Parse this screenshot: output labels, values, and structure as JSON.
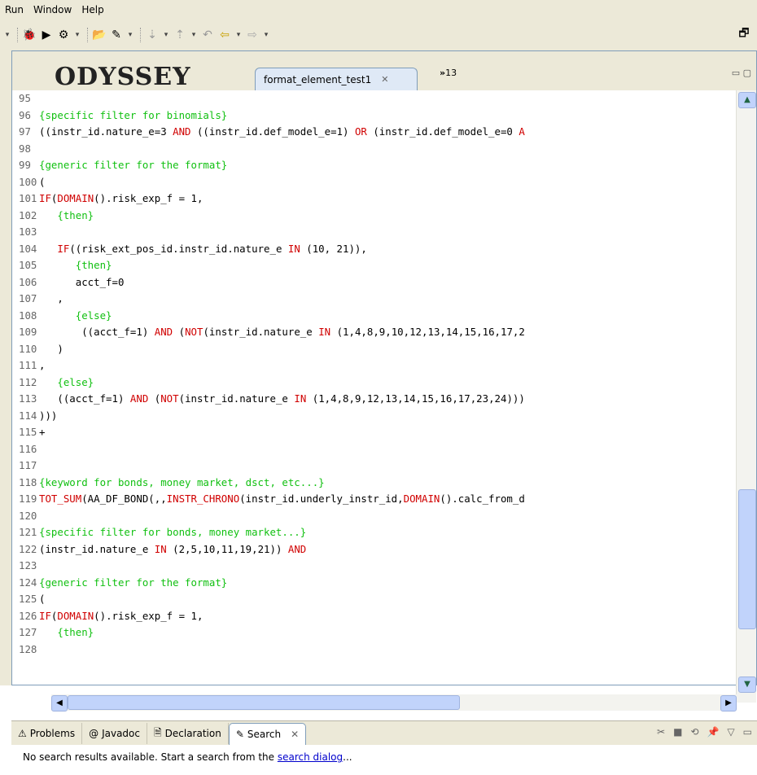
{
  "menubar": {
    "items": [
      "Run",
      "Window",
      "Help"
    ]
  },
  "toolbar": {
    "icons": [
      "debug-icon",
      "run-icon",
      "external-tools-icon",
      "open-folder-icon",
      "search-icon",
      "next-annotation-icon",
      "prev-annotation-icon",
      "back-icon",
      "forward-icon"
    ],
    "perspective_icon": "perspective-icon"
  },
  "editor": {
    "logo_text": "ODYSSEY",
    "active_tab": "format_element_test1",
    "overflow_label": "13",
    "lines": [
      {
        "n": "95",
        "segs": []
      },
      {
        "n": "96",
        "segs": [
          {
            "t": "{specific filter for binomials}",
            "k": "c"
          }
        ]
      },
      {
        "n": "97",
        "segs": [
          {
            "t": "((instr_id.nature_e=3 ",
            "k": "p"
          },
          {
            "t": "AND",
            "k": "k"
          },
          {
            "t": " ((instr_id.def_model_e=1) ",
            "k": "p"
          },
          {
            "t": "OR",
            "k": "k"
          },
          {
            "t": " (instr_id.def_model_e=0 ",
            "k": "p"
          },
          {
            "t": "A",
            "k": "k"
          }
        ]
      },
      {
        "n": "98",
        "segs": []
      },
      {
        "n": "99",
        "segs": [
          {
            "t": "{generic filter for the format}",
            "k": "c"
          }
        ]
      },
      {
        "n": "100",
        "segs": [
          {
            "t": "(",
            "k": "p"
          }
        ]
      },
      {
        "n": "101",
        "segs": [
          {
            "t": "IF",
            "k": "k"
          },
          {
            "t": "(",
            "k": "p"
          },
          {
            "t": "DOMAIN",
            "k": "k"
          },
          {
            "t": "().risk_exp_f = 1,",
            "k": "p"
          }
        ]
      },
      {
        "n": "102",
        "segs": [
          {
            "t": "   {then}",
            "k": "c"
          }
        ]
      },
      {
        "n": "103",
        "segs": []
      },
      {
        "n": "104",
        "segs": [
          {
            "t": "   ",
            "k": "p"
          },
          {
            "t": "IF",
            "k": "k"
          },
          {
            "t": "((risk_ext_pos_id.instr_id.nature_e ",
            "k": "p"
          },
          {
            "t": "IN",
            "k": "k"
          },
          {
            "t": " (10, 21)),",
            "k": "p"
          }
        ]
      },
      {
        "n": "105",
        "segs": [
          {
            "t": "      {then}",
            "k": "c"
          }
        ]
      },
      {
        "n": "106",
        "segs": [
          {
            "t": "      acct_f=0",
            "k": "p"
          }
        ]
      },
      {
        "n": "107",
        "segs": [
          {
            "t": "   ,",
            "k": "p"
          }
        ]
      },
      {
        "n": "108",
        "segs": [
          {
            "t": "      {else}",
            "k": "c"
          }
        ]
      },
      {
        "n": "109",
        "segs": [
          {
            "t": "       ((acct_f=1) ",
            "k": "p"
          },
          {
            "t": "AND",
            "k": "k"
          },
          {
            "t": " (",
            "k": "p"
          },
          {
            "t": "NOT",
            "k": "k"
          },
          {
            "t": "(instr_id.nature_e ",
            "k": "p"
          },
          {
            "t": "IN",
            "k": "k"
          },
          {
            "t": " (1,4,8,9,10,12,13,14,15,16,17,2",
            "k": "p"
          }
        ]
      },
      {
        "n": "110",
        "segs": [
          {
            "t": "   )",
            "k": "p"
          }
        ]
      },
      {
        "n": "111",
        "segs": [
          {
            "t": ",",
            "k": "p"
          }
        ]
      },
      {
        "n": "112",
        "segs": [
          {
            "t": "   {else}",
            "k": "c"
          }
        ]
      },
      {
        "n": "113",
        "segs": [
          {
            "t": "   ((acct_f=1) ",
            "k": "p"
          },
          {
            "t": "AND",
            "k": "k"
          },
          {
            "t": " (",
            "k": "p"
          },
          {
            "t": "NOT",
            "k": "k"
          },
          {
            "t": "(instr_id.nature_e ",
            "k": "p"
          },
          {
            "t": "IN",
            "k": "k"
          },
          {
            "t": " (1,4,8,9,12,13,14,15,16,17,23,24)))",
            "k": "p"
          }
        ]
      },
      {
        "n": "114",
        "segs": [
          {
            "t": ")))",
            "k": "p"
          }
        ]
      },
      {
        "n": "115",
        "segs": [
          {
            "t": "+",
            "k": "p"
          }
        ]
      },
      {
        "n": "116",
        "segs": []
      },
      {
        "n": "117",
        "segs": []
      },
      {
        "n": "118",
        "segs": [
          {
            "t": "{keyword for bonds, money market, dsct, etc...}",
            "k": "c"
          }
        ]
      },
      {
        "n": "119",
        "segs": [
          {
            "t": "TOT_SUM",
            "k": "k"
          },
          {
            "t": "(AA_DF_BOND(,,",
            "k": "p"
          },
          {
            "t": "INSTR_CHRONO",
            "k": "k"
          },
          {
            "t": "(instr_id.underly_instr_id,",
            "k": "p"
          },
          {
            "t": "DOMAIN",
            "k": "k"
          },
          {
            "t": "().calc_from_d",
            "k": "p"
          }
        ]
      },
      {
        "n": "120",
        "segs": []
      },
      {
        "n": "121",
        "segs": [
          {
            "t": "{specific filter for bonds, money market...}",
            "k": "c"
          }
        ]
      },
      {
        "n": "122",
        "segs": [
          {
            "t": "(instr_id.nature_e ",
            "k": "p"
          },
          {
            "t": "IN",
            "k": "k"
          },
          {
            "t": " (2,5,10,11,19,21)) ",
            "k": "p"
          },
          {
            "t": "AND",
            "k": "k"
          }
        ]
      },
      {
        "n": "123",
        "segs": []
      },
      {
        "n": "124",
        "segs": [
          {
            "t": "{generic filter for the format}",
            "k": "c"
          }
        ]
      },
      {
        "n": "125",
        "segs": [
          {
            "t": "(",
            "k": "p"
          }
        ]
      },
      {
        "n": "126",
        "segs": [
          {
            "t": "IF",
            "k": "k"
          },
          {
            "t": "(",
            "k": "p"
          },
          {
            "t": "DOMAIN",
            "k": "k"
          },
          {
            "t": "().risk_exp_f = 1,",
            "k": "p"
          }
        ]
      },
      {
        "n": "127",
        "segs": [
          {
            "t": "   {then}",
            "k": "c"
          }
        ]
      },
      {
        "n": "128",
        "segs": []
      }
    ]
  },
  "bottom_panel": {
    "tabs": [
      {
        "label": "Problems",
        "icon": "problems-icon"
      },
      {
        "label": "Javadoc",
        "icon": "javadoc-icon"
      },
      {
        "label": "Declaration",
        "icon": "declaration-icon"
      },
      {
        "label": "Search",
        "icon": "search-icon"
      }
    ],
    "status_prefix": "No search results available. Start a search from the ",
    "status_link": "search dialog",
    "status_suffix": "..."
  },
  "colors": {
    "keyword": "#d00000",
    "comment": "#11c011",
    "chrome": "#ece9d8",
    "scrollbar": "#c1d3fb"
  }
}
